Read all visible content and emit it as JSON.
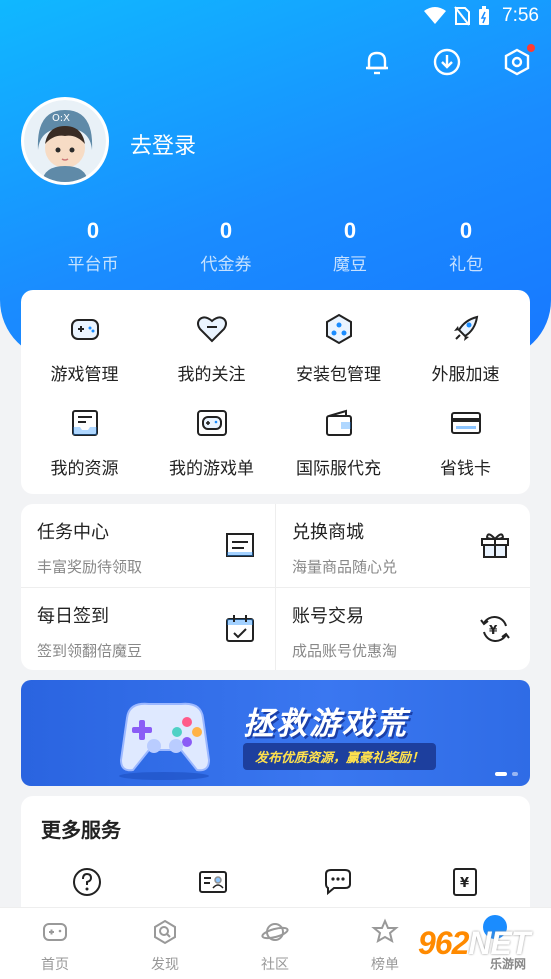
{
  "status_bar": {
    "time": "7:56"
  },
  "header": {
    "login_label": "去登录"
  },
  "stats": [
    {
      "value": "0",
      "label": "平台币"
    },
    {
      "value": "0",
      "label": "代金券"
    },
    {
      "value": "0",
      "label": "魔豆"
    },
    {
      "value": "0",
      "label": "礼包"
    }
  ],
  "grid": [
    {
      "label": "游戏管理",
      "icon": "gamepad-icon"
    },
    {
      "label": "我的关注",
      "icon": "heart-icon"
    },
    {
      "label": "安装包管理",
      "icon": "package-icon"
    },
    {
      "label": "外服加速",
      "icon": "rocket-icon"
    },
    {
      "label": "我的资源",
      "icon": "inbox-icon"
    },
    {
      "label": "我的游戏单",
      "icon": "game-list-icon"
    },
    {
      "label": "国际服代充",
      "icon": "wallet-icon"
    },
    {
      "label": "省钱卡",
      "icon": "card-icon"
    }
  ],
  "tasks": [
    {
      "title": "任务中心",
      "subtitle": "丰富奖励待领取",
      "icon": "task-icon"
    },
    {
      "title": "兑换商城",
      "subtitle": "海量商品随心兑",
      "icon": "gift-icon"
    },
    {
      "title": "每日签到",
      "subtitle": "签到领翻倍魔豆",
      "icon": "calendar-icon"
    },
    {
      "title": "账号交易",
      "subtitle": "成品账号优惠淘",
      "icon": "yen-exchange-icon"
    }
  ],
  "banner": {
    "title": "拯救游戏荒",
    "subtitle": "发布优质资源，赢豪礼奖励！"
  },
  "more": {
    "title": "更多服务"
  },
  "tabs": [
    {
      "label": "首页",
      "icon": "home-gamepad-icon"
    },
    {
      "label": "发现",
      "icon": "discover-icon"
    },
    {
      "label": "社区",
      "icon": "planet-icon"
    },
    {
      "label": "榜单",
      "icon": "star-badge-icon"
    }
  ],
  "watermark": {
    "big": "962",
    "suffix": "NET",
    "small": "乐游网"
  },
  "colors": {
    "primary": "#1a8cff",
    "hero_start": "#10b8ff",
    "text_muted": "#888888"
  }
}
